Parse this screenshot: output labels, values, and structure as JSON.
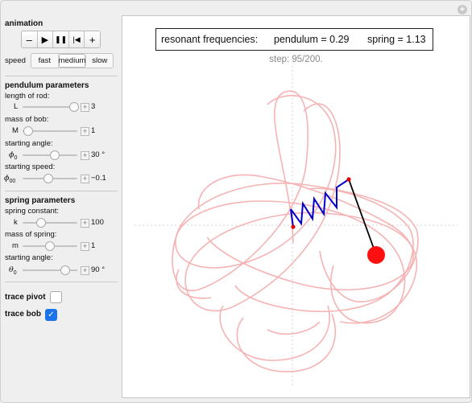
{
  "animation": {
    "title": "animation",
    "buttons": [
      "–",
      "▶",
      "❚❚",
      "|◀",
      "+"
    ]
  },
  "speed": {
    "label": "speed",
    "options": [
      "fast",
      "medium",
      "slow"
    ],
    "selected": "medium"
  },
  "pendulum": {
    "title": "pendulum parameters",
    "length_label": "length of rod:",
    "L_sym": "L",
    "L_value": "3",
    "L_fraction": 0.93,
    "mass_label": "mass of bob:",
    "M_sym": "M",
    "M_value": "1",
    "M_fraction": 0.09,
    "angle_label": "starting angle:",
    "phi0_value": "30 °",
    "phi0_fraction": 0.58,
    "speed_label": "starting speed:",
    "phi00_value": "−0.1",
    "phi00_fraction": 0.46
  },
  "spring": {
    "title": "spring parameters",
    "k_label": "spring constant:",
    "k_sym": "k",
    "k_value": "100",
    "k_fraction": 0.33,
    "mass_label": "mass of spring:",
    "m_sym": "m",
    "m_value": "1",
    "m_fraction": 0.49,
    "angle_label": "starting angle:",
    "theta0_value": "90 °",
    "theta0_fraction": 0.76
  },
  "trace": {
    "pivot_label": "trace pivot",
    "pivot_checked": false,
    "bob_label": "trace bob",
    "bob_checked": true
  },
  "plot": {
    "freq_title": "resonant frequencies:",
    "pendulum_freq": "pendulum = 0.29",
    "spring_freq": "spring = 1.13",
    "step_text": "step: 95/200.",
    "colors": {
      "trace": "#f7b7b7",
      "spring": "#0000cc",
      "bob": "#ff0000",
      "rod": "#000000",
      "axes": "#bbbbbb"
    }
  }
}
